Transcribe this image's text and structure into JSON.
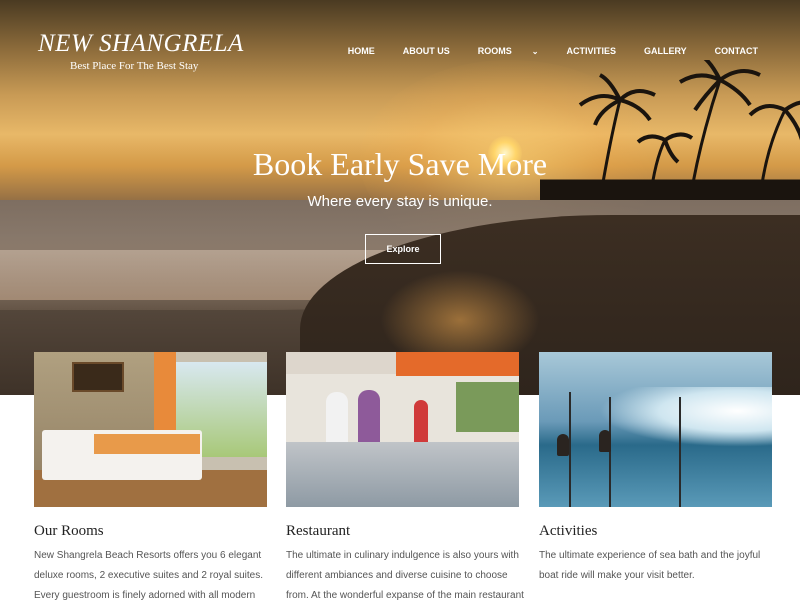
{
  "brand": {
    "title": "NEW SHANGRELA",
    "tagline": "Best Place For The Best Stay"
  },
  "nav": [
    {
      "label": "HOME"
    },
    {
      "label": "ABOUT US"
    },
    {
      "label": "ROOMS",
      "has_dropdown": true
    },
    {
      "label": "ACTIVITIES"
    },
    {
      "label": "GALLERY"
    },
    {
      "label": "CONTACT"
    }
  ],
  "hero": {
    "title": "Book Early Save More",
    "subtitle": "Where every stay is unique.",
    "button": "Explore"
  },
  "cards": [
    {
      "title": "Our Rooms",
      "text": "New Shangrela Beach Resorts offers you 6 elegant deluxe rooms, 2 executive suites and 2 royal suites. Every guestroom is finely adorned with all modern"
    },
    {
      "title": "Restaurant",
      "text": "The ultimate in culinary indulgence is also yours with different ambiances and diverse cuisine to choose from. At the wonderful expanse of the main restaurant"
    },
    {
      "title": "Activities",
      "text": "The ultimate experience of sea bath and the joyful boat ride will make your visit better."
    }
  ],
  "colors": {
    "nav_text": "#ffffff",
    "card_text": "#555555",
    "card_title": "#222222"
  }
}
